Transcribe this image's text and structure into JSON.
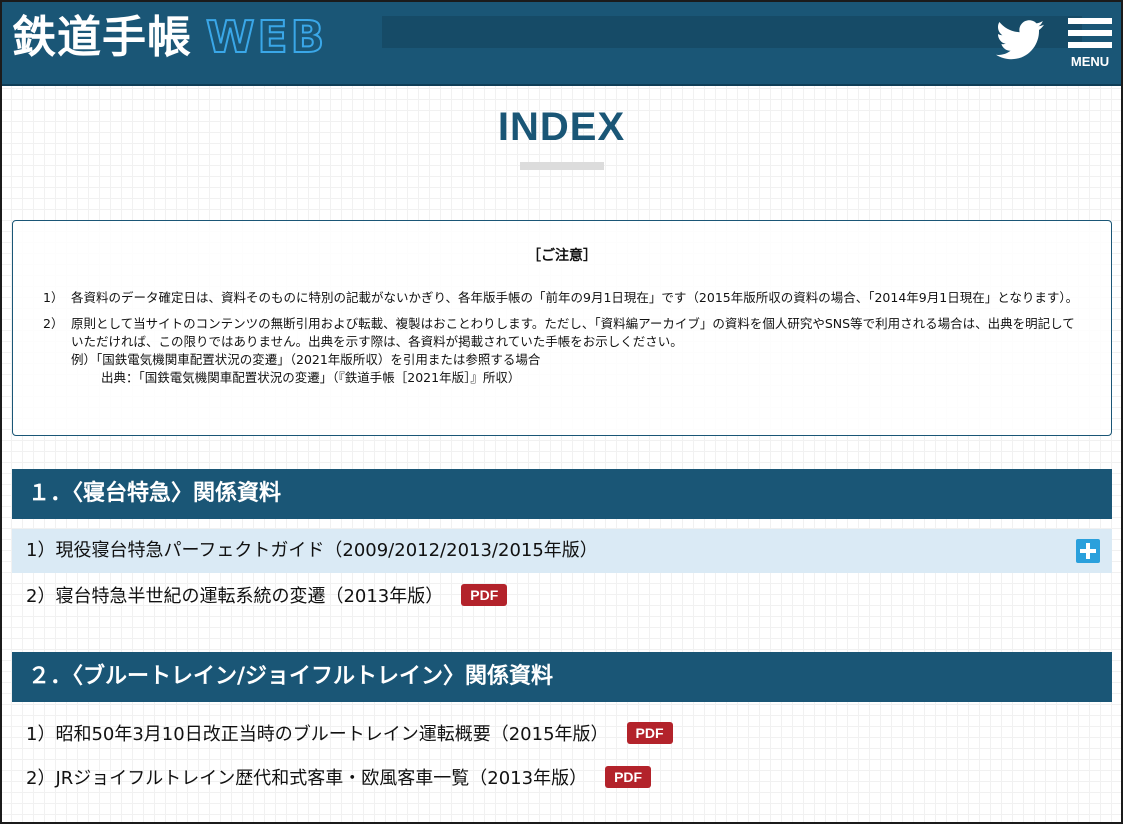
{
  "header": {
    "logo_ja": "鉄道手帳",
    "logo_web": "WEB",
    "menu_label": "MENU",
    "twitter_icon": "twitter-icon",
    "menu_icon": "hamburger-icon",
    "colors": {
      "bar": "#1a5676",
      "accent": "#3aa7e8"
    }
  },
  "page": {
    "title": "INDEX"
  },
  "notice": {
    "title": "［ご注意］",
    "items": [
      {
        "num": "1）",
        "text": "各資料のデータ確定日は、資料そのものに特別の記載がないかぎり、各年版手帳の「前年の9月1日現在」です（2015年版所収の資料の場合、「2014年9月1日現在」となります）。"
      },
      {
        "num": "2）",
        "text": "原則として当サイトのコンテンツの無断引用および転載、複製はおことわりします。ただし、「資料編アーカイブ」の資料を個人研究やSNS等で利用される場合は、出典を明記していただければ、この限りではありません。出典を示す際は、各資料が掲載されていた手帳をお示しください。",
        "example": "例）「国鉄電気機関車配置状況の変遷」（2021年版所収）を引用または参照する場合",
        "source": "出典：「国鉄電気機関車配置状況の変遷」（『鉄道手帳［2021年版］』所収）"
      }
    ]
  },
  "sections": [
    {
      "title": "１．〈寝台特急〉関係資料",
      "items": [
        {
          "label": "1）現役寝台特急パーフェクトガイド（2009/2012/2013/2015年版）",
          "action_icon": "plus-icon"
        },
        {
          "label": "2）寝台特急半世紀の運転系統の変遷（2013年版）",
          "badge": "PDF"
        }
      ]
    },
    {
      "title": "２．〈ブルートレイン/ジョイフルトレイン〉関係資料",
      "items": [
        {
          "label": "1）昭和50年3月10日改正当時のブルートレイン運転概要（2015年版）",
          "badge": "PDF"
        },
        {
          "label": "2）JRジョイフルトレイン歴代和式客車・欧風客車一覧（2013年版）",
          "badge": "PDF"
        }
      ]
    }
  ]
}
